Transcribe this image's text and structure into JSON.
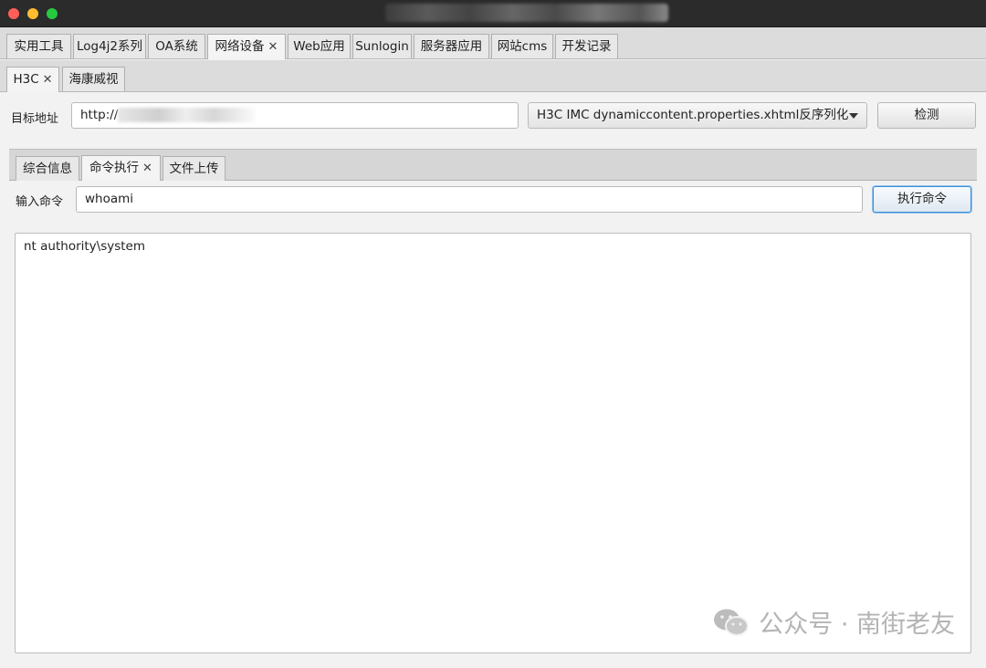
{
  "main_tabs": [
    {
      "label": "实用工具"
    },
    {
      "label": "Log4j2系列"
    },
    {
      "label": "OA系统"
    },
    {
      "label": "网络设备",
      "closable": true,
      "active": true
    },
    {
      "label": "Web应用"
    },
    {
      "label": "Sunlogin"
    },
    {
      "label": "服务器应用"
    },
    {
      "label": "网站cms"
    },
    {
      "label": "开发记录"
    }
  ],
  "vendor_tabs": [
    {
      "label": "H3C",
      "closable": true,
      "active": true
    },
    {
      "label": "海康威视"
    }
  ],
  "target": {
    "label": "目标地址",
    "value": "http://"
  },
  "exploit_select": {
    "value": "H3C IMC dynamiccontent.properties.xhtml反序列化"
  },
  "detect_button": "检测",
  "function_tabs": [
    {
      "label": "综合信息"
    },
    {
      "label": "命令执行",
      "closable": true,
      "active": true
    },
    {
      "label": "文件上传"
    }
  ],
  "command": {
    "label": "输入命令",
    "value": "whoami",
    "button": "执行命令"
  },
  "output": {
    "text": "nt authority\\system"
  },
  "watermark": {
    "text": "公众号 · 南街老友"
  },
  "close_glyph": "✕",
  "colors": {
    "titlebar": "#2b2b2b",
    "traffic_close": "#ff5f57",
    "traffic_min": "#febc2e",
    "traffic_max": "#28c840",
    "focus_blue": "#3d8fd6"
  }
}
